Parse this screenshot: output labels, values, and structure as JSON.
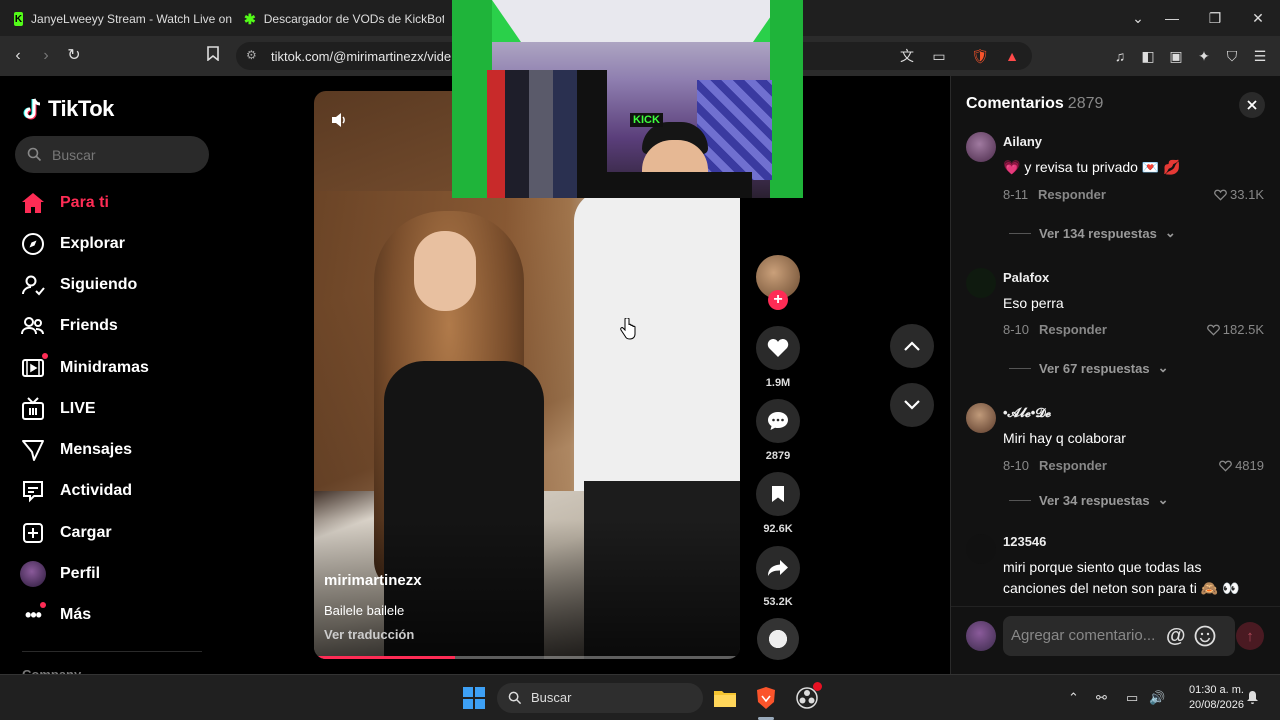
{
  "browser": {
    "tabs": [
      {
        "title": "JanyeLweeyy Stream - Watch Live on",
        "favicon_color": "#53fc18",
        "favicon_letter": "K"
      },
      {
        "title": "Descargador de VODs de KickBot",
        "favicon_color": "#53fc18",
        "favicon_letter": "K"
      }
    ],
    "url": "tiktok.com/@mirimartinezx/vide"
  },
  "tiktok": {
    "logo_text": "TikTok",
    "search_placeholder": "Buscar",
    "nav": [
      {
        "label": "Para ti",
        "icon": "home-icon",
        "active": true
      },
      {
        "label": "Explorar",
        "icon": "compass-icon"
      },
      {
        "label": "Siguiendo",
        "icon": "following-icon"
      },
      {
        "label": "Friends",
        "icon": "friends-icon"
      },
      {
        "label": "Minidramas",
        "icon": "minidramas-icon"
      },
      {
        "label": "LIVE",
        "icon": "live-icon"
      },
      {
        "label": "Mensajes",
        "icon": "messages-icon"
      },
      {
        "label": "Actividad",
        "icon": "activity-icon"
      },
      {
        "label": "Cargar",
        "icon": "upload-icon"
      },
      {
        "label": "Perfil",
        "icon": "profile-avatar"
      },
      {
        "label": "Más",
        "icon": "more-icon"
      }
    ],
    "company_label": "Company",
    "accent": "#fe2c55"
  },
  "video": {
    "author": "mirimartinezx",
    "caption": "Bailele bailele",
    "translate_label": "Ver traducción",
    "progress": 0.33,
    "pip_label": "KICK"
  },
  "actions": {
    "likes": "1.9M",
    "comments": "2879",
    "saves": "92.6K",
    "shares": "53.2K"
  },
  "comments_panel": {
    "title": "Comentarios",
    "count": "2879",
    "items": [
      {
        "user": "Ailany",
        "text": "💗 y revisa tu privado 💌 💋",
        "date": "8-11",
        "reply": "Responder",
        "likes": "33.1K",
        "more": "Ver 134 respuestas",
        "avatar_color": "#6a4a6a"
      },
      {
        "user": "Palafox",
        "text": "Eso perra",
        "date": "8-10",
        "reply": "Responder",
        "likes": "182.5K",
        "more": "Ver 67 respuestas",
        "avatar_color": "#0f1a0f"
      },
      {
        "user": "•𝓐𝓵𝓮•𝓓𝓮",
        "text": "Miri hay q colaborar",
        "date": "8-10",
        "reply": "Responder",
        "likes": "4819",
        "more": "Ver 34 respuestas",
        "avatar_color": "#8a6a5a"
      },
      {
        "user": "123546",
        "text": "miri porque siento que todas las canciones del neton son para ti 🙈 👀",
        "avatar_color": "#111111"
      }
    ],
    "input_placeholder": "Agregar comentario..."
  },
  "taskbar": {
    "search_label": "Buscar",
    "time": "01:30 a. m.",
    "date": "20/08/2026"
  }
}
